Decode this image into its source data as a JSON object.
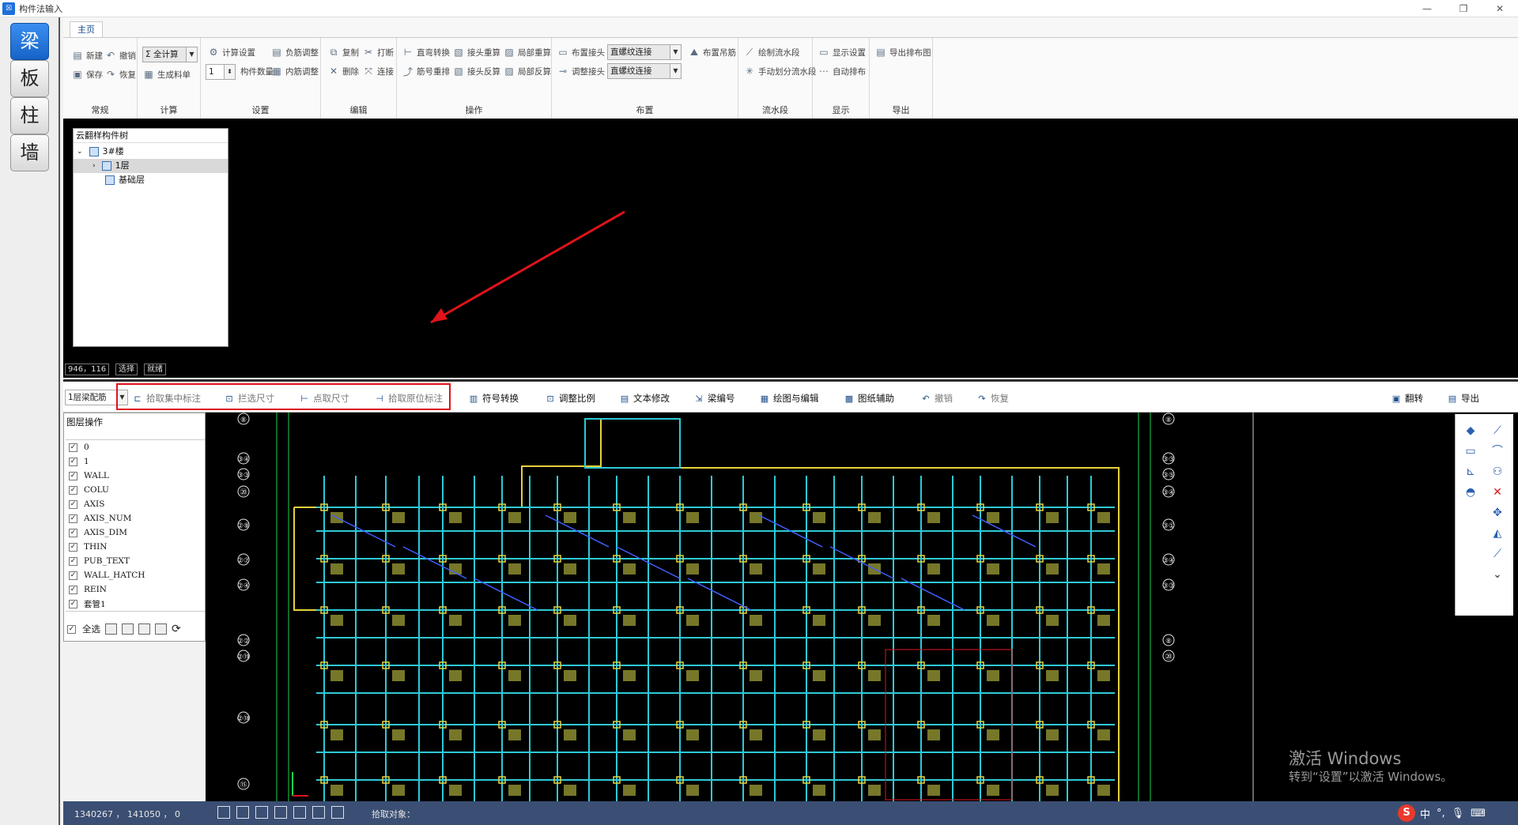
{
  "window": {
    "title": "构件法输入"
  },
  "modules": [
    "梁",
    "板",
    "柱",
    "墙"
  ],
  "ribbon": {
    "tab": "主页",
    "groups": {
      "changgui": {
        "label": "常规",
        "new": "新建",
        "undo": "撤销",
        "save": "保存",
        "redo": "恢复"
      },
      "jisuan": {
        "label": "计算",
        "calc_all": "全计算",
        "gen_list": "生成料单"
      },
      "shezhi": {
        "label": "设置",
        "calc_setting": "计算设置",
        "neg_adjust": "负筋调整",
        "spin_value": "1",
        "member_count": "构件数量",
        "inner_adjust": "内筋调整"
      },
      "bianji": {
        "label": "编辑",
        "copy": "复制",
        "break": "打断",
        "delete": "删除",
        "connect": "连接"
      },
      "caozuo": {
        "label": "操作",
        "straight_conv": "直弯转换",
        "joint_recalc": "接头重算",
        "local_recalc": "局部重算",
        "rebar_rearrange": "筋号重排",
        "joint_reverse": "接头反算",
        "local_reverse": "局部反算"
      },
      "buzhi": {
        "label": "布置",
        "place_joint": "布置接头",
        "joint_type_1": "直螺纹连接",
        "adjust_joint": "调整接头",
        "joint_type_2": "直螺纹连接",
        "place_hanging": "布置吊筋"
      },
      "liushuiduan": {
        "label": "流水段",
        "draw_section": "绘制流水段",
        "manual_section": "手动划分流水段"
      },
      "xianshi": {
        "label": "显示",
        "display_setting": "显示设置",
        "auto_layout": "自动排布"
      },
      "daochu": {
        "label": "导出",
        "export_layout": "导出排布图"
      }
    }
  },
  "tree": {
    "title": "云翻样构件树",
    "building": "3#楼",
    "floor_1": "1层",
    "foundation": "基础层"
  },
  "upper_status": {
    "coords": "946，116",
    "mode": "选择",
    "state": "就绪"
  },
  "lower_toolbar": {
    "layer_select": "1层梁配筋",
    "pick_concentrated": "拾取集中标注",
    "box_dimension": "拦选尺寸",
    "point_dimension": "点取尺寸",
    "pick_original": "拾取原位标注",
    "symbol_convert": "符号转换",
    "adjust_scale": "调整比例",
    "text_edit": "文本修改",
    "beam_number": "梁编号",
    "draw_edit": "绘图与编辑",
    "drawing_aid": "图纸辅助",
    "undo": "撤销",
    "redo": "恢复",
    "flip": "翻转",
    "export": "导出"
  },
  "layers": {
    "title": "图层操作",
    "items": [
      "0",
      "1",
      "WALL",
      "COLU",
      "AXIS",
      "AXIS_NUM",
      "AXIS_DIM",
      "THIN",
      "PUB_TEXT",
      "WALL_HATCH",
      "REIN",
      "套管1"
    ],
    "select_all": "全选"
  },
  "cad_axis_left": [
    "⑧",
    "③④",
    "③③",
    "⑳",
    "②⑧",
    "②⑦",
    "②④",
    "②②",
    "②⑲",
    "②⑱",
    "⑮"
  ],
  "cad_axis_right": [
    "⑧",
    "③③",
    "③⑤",
    "③④",
    "③①",
    "③④",
    "③③",
    "⑧",
    "⑳"
  ],
  "statusbar": {
    "coords": "1340267 ， 141050 ， 0",
    "message": "拾取对象："
  },
  "activation": {
    "line1": "激活 Windows",
    "line2": "转到“设置”以激活 Windows。"
  },
  "ime": {
    "lang": "中"
  },
  "colors": {
    "accent": "#1663c7",
    "highlight": "#e0131a",
    "statusbar": "#3b4f74",
    "cad_bg": "#000000"
  }
}
